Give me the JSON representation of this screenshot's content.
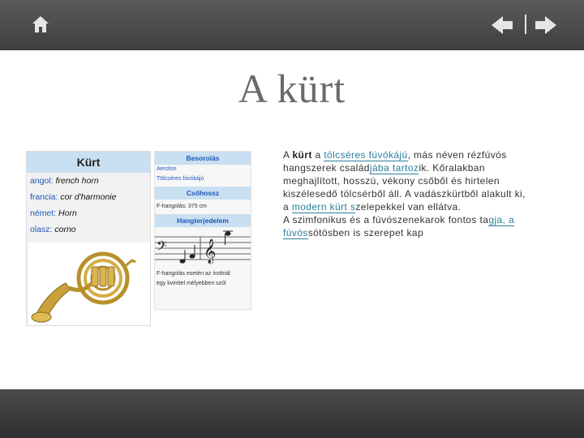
{
  "toolbar": {
    "home_icon": "home-icon",
    "prev_icon": "arrow-left-icon",
    "next_icon": "arrow-right-icon",
    "separator": "|"
  },
  "slide": {
    "title": "A kürt"
  },
  "infobox": {
    "title": "Kürt",
    "rows": [
      {
        "key": "angol:",
        "value": "french horn"
      },
      {
        "key": "francia:",
        "value": "cor d'harmonie"
      },
      {
        "key": "német:",
        "value": "Horn"
      },
      {
        "key": "olasz:",
        "value": "corno"
      }
    ],
    "sections": {
      "besorolas": "Besorolás",
      "besorolas_lines": [
        "Aerofon",
        "Tölcséres fúvókájú"
      ],
      "csohossz": "Csőhossz",
      "csohossz_line": "F-hangolás: 375 cm",
      "hangterjedelem": "Hangterjedelem",
      "hangterjedelem_lines": [
        "F-hangolás esetén az írottnál",
        "egy kvinttel mélyebben szól"
      ]
    }
  },
  "body": {
    "p1_a": "A ",
    "p1_kurt": "kürt",
    "p1_b": " a ",
    "link_tolcseres": "tölcséres fúvókájú",
    "p1_c": ", más néven rézfúvós hangszerek család",
    "link_jaba": "jába tartoz",
    "p1_d": "ik. Kőralakban meghajlított, hosszú, vékony csőből és hirtelen kiszélesedő tölcsérből áll. A vadászkürtből alakult ki, a ",
    "link_modern": "modern kürt s",
    "p1_e": "zelepekkel van ellátva.",
    "p2_a": "A szimfonikus és a fúvószenekarok fontos ta",
    "link_gja": "gja, a",
    "p2_b": " ",
    "link_fuvos": "fúvós",
    "p2_c": "sötösben is szerepet kap"
  },
  "colors": {
    "topbar": "#4a4a4a",
    "title": "#6a6a6a",
    "link": "#2a7e9a",
    "infobox_head": "#c9dff2",
    "infobox_key": "#1f56b8"
  }
}
